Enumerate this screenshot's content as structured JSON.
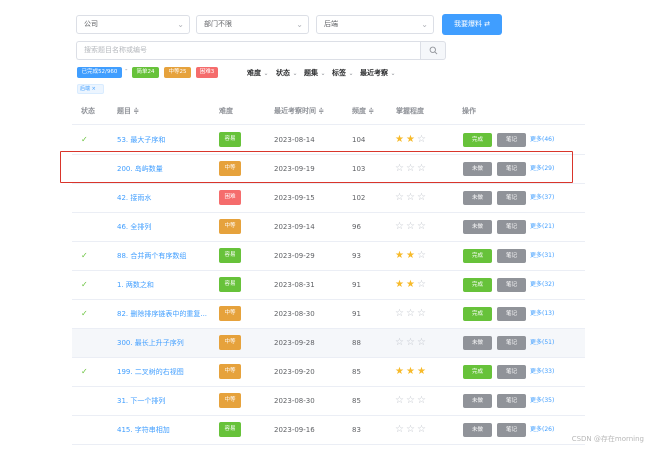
{
  "filters": {
    "company": "公司",
    "department": "部门不限",
    "role": "后端",
    "primary_button": "我要爆料 ⇄"
  },
  "search": {
    "placeholder": "搜索题目名称或编号"
  },
  "stats": {
    "done": "已完成52/960",
    "easy": "简单24",
    "medium": "中等25",
    "hard": "困难3"
  },
  "sort_filters": [
    "难度",
    "状态",
    "题集",
    "标签",
    "最近考察"
  ],
  "active_tag": "后端 ×",
  "table": {
    "headers": {
      "status": "状态",
      "title": "题目 ≑",
      "difficulty": "难度",
      "last_time": "最近考察时间 ≑",
      "frequency": "频度 ≑",
      "mastery": "掌握程度",
      "actions": "操作"
    },
    "rows": [
      {
        "done": true,
        "check": "✓",
        "title": "53. 最大子序和",
        "difficulty": "容易",
        "date": "2023-08-14",
        "freq": "104",
        "stars": "★★☆",
        "status_btn": "完成",
        "note": "笔记",
        "more": "更多(46)"
      },
      {
        "done": false,
        "check": "",
        "title": "200. 岛屿数量",
        "difficulty": "中等",
        "date": "2023-09-19",
        "freq": "103",
        "stars": "☆☆☆",
        "status_btn": "未做",
        "note": "笔记",
        "more": "更多(29)"
      },
      {
        "done": false,
        "check": "",
        "title": "42. 接雨水",
        "difficulty": "困难",
        "date": "2023-09-15",
        "freq": "102",
        "stars": "☆☆☆",
        "status_btn": "未做",
        "note": "笔记",
        "more": "更多(37)"
      },
      {
        "done": false,
        "check": "",
        "title": "46. 全排列",
        "difficulty": "中等",
        "date": "2023-09-14",
        "freq": "96",
        "stars": "☆☆☆",
        "status_btn": "未做",
        "note": "笔记",
        "more": "更多(21)"
      },
      {
        "done": true,
        "check": "✓",
        "title": "88. 合并两个有序数组",
        "difficulty": "容易",
        "date": "2023-09-29",
        "freq": "93",
        "stars": "★★☆",
        "status_btn": "完成",
        "note": "笔记",
        "more": "更多(31)"
      },
      {
        "done": true,
        "check": "✓",
        "title": "1. 两数之和",
        "difficulty": "容易",
        "date": "2023-08-31",
        "freq": "91",
        "stars": "★★☆",
        "status_btn": "完成",
        "note": "笔记",
        "more": "更多(32)"
      },
      {
        "done": true,
        "check": "✓",
        "title": "82. 删除排序链表中的重复...",
        "difficulty": "中等",
        "date": "2023-08-30",
        "freq": "91",
        "stars": "☆☆☆",
        "status_btn": "完成",
        "note": "笔记",
        "more": "更多(13)"
      },
      {
        "done": false,
        "check": "",
        "title": "300. 最长上升子序列",
        "difficulty": "中等",
        "date": "2023-09-28",
        "freq": "88",
        "stars": "☆☆☆",
        "status_btn": "未做",
        "note": "笔记",
        "more": "更多(51)"
      },
      {
        "done": true,
        "check": "✓",
        "title": "199. 二叉树的右视图",
        "difficulty": "中等",
        "date": "2023-09-20",
        "freq": "85",
        "stars": "★★★",
        "status_btn": "完成",
        "note": "笔记",
        "more": "更多(33)"
      },
      {
        "done": false,
        "check": "",
        "title": "31. 下一个排列",
        "difficulty": "中等",
        "date": "2023-08-30",
        "freq": "85",
        "stars": "☆☆☆",
        "status_btn": "未做",
        "note": "笔记",
        "more": "更多(35)"
      },
      {
        "done": false,
        "check": "",
        "title": "415. 字符串相加",
        "difficulty": "容易",
        "date": "2023-09-16",
        "freq": "83",
        "stars": "☆☆☆",
        "status_btn": "未做",
        "note": "笔记",
        "more": "更多(26)"
      }
    ]
  },
  "colors": {
    "primary": "#409eff",
    "easy": "#67c23a",
    "medium": "#e6a23c",
    "hard": "#f56c6c",
    "done_button": "#67c23a",
    "todo_button": "#909399",
    "highlight_box": "#d9352b"
  },
  "watermark": "CSDN @存在morning"
}
